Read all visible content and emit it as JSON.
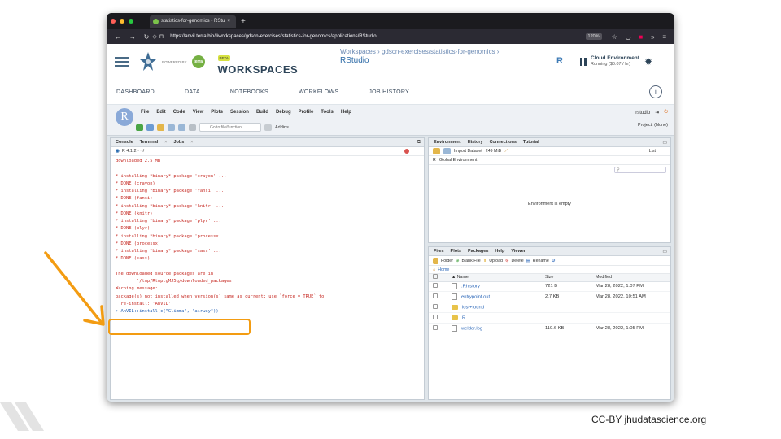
{
  "browser": {
    "tab_title": "statistics-for-genomics - RStu",
    "tab_close": "×",
    "new_tab": "+",
    "url": "https://anvil.terra.bio/#workspaces/gdscn-exercises/statistics-for-genomics/applications/RStudio",
    "zoom": "120%",
    "dot_colors": [
      "#ff5f57",
      "#febc2e",
      "#28c840"
    ]
  },
  "terra": {
    "powered_by": "POWERED BY",
    "terra_badge": "terra",
    "beta": "BETA",
    "brand": "WORKSPACES",
    "breadcrumb": "Workspaces › gdscn-exercises/statistics-for-genomics ›",
    "app_title": "RStudio",
    "r_letter": "R",
    "cloud_title": "Cloud Environment",
    "cloud_status": "Running ($0.07 / hr)",
    "nav": [
      "DASHBOARD",
      "DATA",
      "NOTEBOOKS",
      "WORKFLOWS",
      "JOB HISTORY"
    ],
    "info": "i"
  },
  "rstudio": {
    "r_logo": "R",
    "menu": [
      "File",
      "Edit",
      "Code",
      "View",
      "Plots",
      "Session",
      "Build",
      "Debug",
      "Profile",
      "Tools",
      "Help"
    ],
    "goto_placeholder": "Go to file/function",
    "addins": "Addins",
    "user": "rstudio",
    "project": "Project: (None)"
  },
  "console": {
    "tabs": [
      "Console",
      "Terminal",
      "Jobs"
    ],
    "path": "R 4.1.2 · ~/",
    "lines": [
      {
        "text": "downloaded 2.5 MB",
        "cls": "red"
      },
      {
        "text": "",
        "cls": "red"
      },
      {
        "text": "* installing *binary* package 'crayon' ...",
        "cls": "red"
      },
      {
        "text": "* DONE (crayon)",
        "cls": "red"
      },
      {
        "text": "* installing *binary* package 'fansi' ...",
        "cls": "red"
      },
      {
        "text": "* DONE (fansi)",
        "cls": "red"
      },
      {
        "text": "* installing *binary* package 'knitr' ...",
        "cls": "red"
      },
      {
        "text": "* DONE (knitr)",
        "cls": "red"
      },
      {
        "text": "* installing *binary* package 'plyr' ...",
        "cls": "red"
      },
      {
        "text": "* DONE (plyr)",
        "cls": "red"
      },
      {
        "text": "* installing *binary* package 'processx' ...",
        "cls": "red"
      },
      {
        "text": "* DONE (processx)",
        "cls": "red"
      },
      {
        "text": "* installing *binary* package 'sass' ...",
        "cls": "red"
      },
      {
        "text": "* DONE (sass)",
        "cls": "red"
      },
      {
        "text": "",
        "cls": "red"
      },
      {
        "text": "The downloaded source packages are in",
        "cls": "red"
      },
      {
        "text": "        '/tmp/RtmptgMJ5q/downloaded_packages'",
        "cls": "red"
      },
      {
        "text": "Warning message:",
        "cls": "red"
      },
      {
        "text": "package(s) not installed when version(s) same as current; use `force = TRUE` to",
        "cls": "red"
      },
      {
        "text": "  re-install: 'AnVIL'",
        "cls": "red"
      },
      {
        "text": "> AnVIL::install(c(\"Glimma\", \"airway\"))",
        "cls": "blue"
      }
    ]
  },
  "environment": {
    "tabs": [
      "Environment",
      "History",
      "Connections",
      "Tutorial"
    ],
    "import_dataset": "Import Dataset",
    "memory": "249 MiB",
    "list_view": "List",
    "lang": "R",
    "scope": "Global Environment",
    "empty_msg": "Environment is empty"
  },
  "files": {
    "tabs": [
      "Files",
      "Plots",
      "Packages",
      "Help",
      "Viewer"
    ],
    "toolbar": [
      "Folder",
      "Blank File",
      "Upload",
      "Delete",
      "Rename"
    ],
    "home": "Home",
    "columns": [
      "▲ Name",
      "Size",
      "Modified"
    ],
    "rows": [
      {
        "name": ".Rhistory",
        "size": "721 B",
        "modified": "Mar 28, 2022, 1:07 PM",
        "kind": "file"
      },
      {
        "name": "entrypoint.out",
        "size": "2.7 KB",
        "modified": "Mar 28, 2022, 10:51 AM",
        "kind": "file"
      },
      {
        "name": "lost+found",
        "size": "",
        "modified": "",
        "kind": "folder"
      },
      {
        "name": "R",
        "size": "",
        "modified": "",
        "kind": "folder"
      },
      {
        "name": "welder.log",
        "size": "119.6 KB",
        "modified": "Mar 28, 2022, 1:05 PM",
        "kind": "file"
      }
    ]
  },
  "annotation": {
    "arrow_color": "#f39c12"
  },
  "credit": "CC-BY  jhudatascience.org"
}
